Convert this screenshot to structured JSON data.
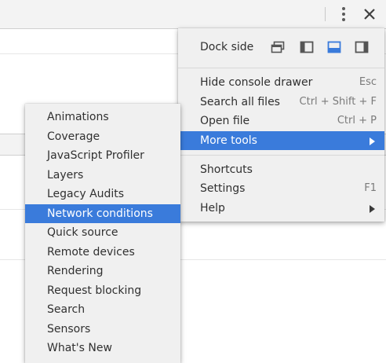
{
  "main_menu": {
    "dock_side_label": "Dock side",
    "items": [
      {
        "label": "Hide console drawer",
        "shortcut": "Esc"
      },
      {
        "label": "Search all files",
        "shortcut": "Ctrl + Shift + F"
      },
      {
        "label": "Open file",
        "shortcut": "Ctrl + P"
      },
      {
        "label": "More tools",
        "shortcut": ""
      },
      {
        "label": "Shortcuts",
        "shortcut": ""
      },
      {
        "label": "Settings",
        "shortcut": "F1"
      },
      {
        "label": "Help",
        "shortcut": ""
      }
    ]
  },
  "more_tools_menu": {
    "items": [
      "Animations",
      "Coverage",
      "JavaScript Profiler",
      "Layers",
      "Legacy Audits",
      "Network conditions",
      "Quick source",
      "Remote devices",
      "Rendering",
      "Request blocking",
      "Search",
      "Sensors",
      "What's New"
    ]
  },
  "colors": {
    "highlight": "#3a7bdb",
    "active_dock": "#3a7bdb"
  }
}
